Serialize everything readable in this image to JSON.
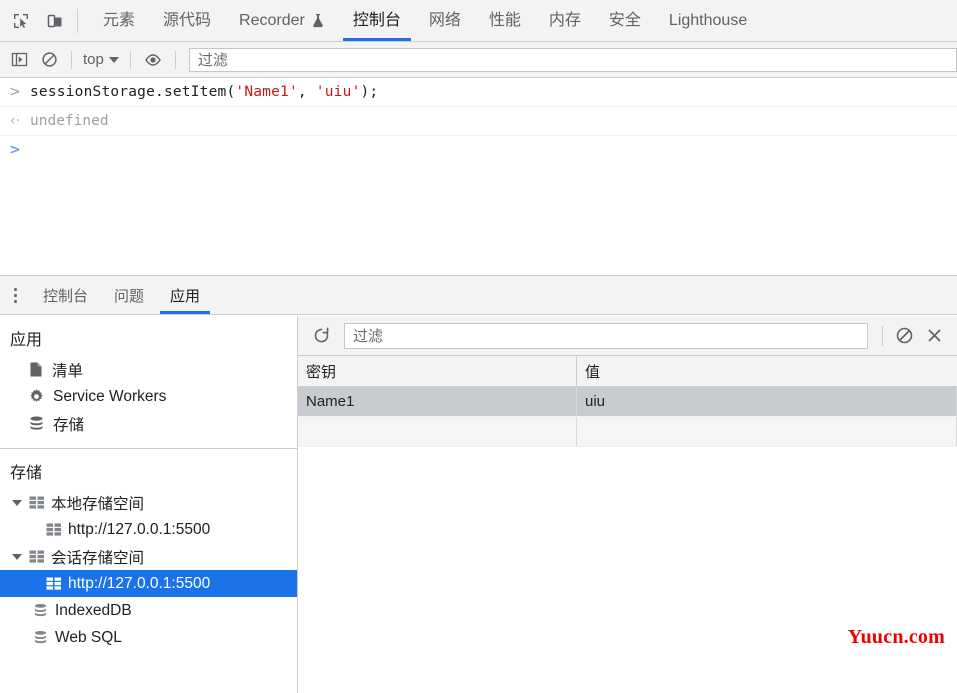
{
  "main_tabbar": {
    "inspect_icon": "inspect-cursor-icon",
    "device_icon": "device-toolbar-icon",
    "tabs": [
      {
        "label": "元素",
        "name": "tab-elements",
        "active": false
      },
      {
        "label": "源代码",
        "name": "tab-sources",
        "active": false
      },
      {
        "label": "Recorder",
        "name": "tab-recorder",
        "active": false,
        "icon": "experiment-flask-icon"
      },
      {
        "label": "控制台",
        "name": "tab-console",
        "active": true
      },
      {
        "label": "网络",
        "name": "tab-network",
        "active": false
      },
      {
        "label": "性能",
        "name": "tab-performance",
        "active": false
      },
      {
        "label": "内存",
        "name": "tab-memory",
        "active": false
      },
      {
        "label": "安全",
        "name": "tab-security",
        "active": false
      },
      {
        "label": "Lighthouse",
        "name": "tab-lighthouse",
        "active": false
      }
    ]
  },
  "console_toolbar": {
    "sidebar_toggle_icon": "console-sidebar-icon",
    "clear_icon": "clear-console-icon",
    "context": "top",
    "eye_icon": "live-expression-eye-icon",
    "filter_placeholder": "过滤"
  },
  "console": {
    "entries": [
      {
        "gutter": ">",
        "type": "input",
        "parts": [
          {
            "text": "sessionStorage.setItem(",
            "kind": "code"
          },
          {
            "text": "'Name1'",
            "kind": "string"
          },
          {
            "text": ", ",
            "kind": "code"
          },
          {
            "text": "'uiu'",
            "kind": "string"
          },
          {
            "text": ");",
            "kind": "code"
          }
        ]
      },
      {
        "gutter": "‹·",
        "type": "output",
        "text": "undefined"
      }
    ],
    "prompt_gutter": ">"
  },
  "drawer": {
    "kebab_icon": "more-options-icon",
    "tabs": [
      {
        "label": "控制台",
        "name": "drawer-tab-console",
        "active": false
      },
      {
        "label": "问题",
        "name": "drawer-tab-issues",
        "active": false
      },
      {
        "label": "应用",
        "name": "drawer-tab-application",
        "active": true
      }
    ]
  },
  "sidebar": {
    "application": {
      "title": "应用",
      "items": [
        {
          "label": "清单",
          "icon": "manifest-document-icon",
          "name": "sidebar-item-manifest"
        },
        {
          "label": "Service Workers",
          "icon": "gear-icon",
          "name": "sidebar-item-service-workers"
        },
        {
          "label": "存储",
          "icon": "database-icon",
          "name": "sidebar-item-storage"
        }
      ]
    },
    "storage": {
      "title": "存储",
      "tree": [
        {
          "label": "本地存储空间",
          "icon": "table-grid-icon",
          "expanded": true,
          "depth": 1,
          "selected": false,
          "name": "tree-local-storage"
        },
        {
          "label": "http://127.0.0.1:5500",
          "icon": "table-grid-icon",
          "depth": 2,
          "selected": false,
          "name": "tree-local-storage-origin"
        },
        {
          "label": "会话存储空间",
          "icon": "table-grid-icon",
          "expanded": true,
          "depth": 1,
          "selected": false,
          "name": "tree-session-storage"
        },
        {
          "label": "http://127.0.0.1:5500",
          "icon": "table-grid-icon",
          "depth": 2,
          "selected": true,
          "name": "tree-session-storage-origin"
        },
        {
          "label": "IndexedDB",
          "icon": "database-icon",
          "depth": 1.5,
          "selected": false,
          "name": "tree-indexeddb"
        },
        {
          "label": "Web SQL",
          "icon": "database-icon",
          "depth": 1.5,
          "selected": false,
          "name": "tree-web-sql"
        }
      ]
    }
  },
  "storage_panel": {
    "refresh_icon": "refresh-icon",
    "clear_icon": "clear-all-icon",
    "delete_icon": "delete-selected-icon",
    "filter_placeholder": "过滤",
    "columns": [
      {
        "label": "密钥",
        "name": "column-header-key"
      },
      {
        "label": "值",
        "name": "column-header-value"
      }
    ],
    "rows": [
      {
        "key": "Name1",
        "value": "uiu",
        "selected": true
      }
    ],
    "empty_rows": 1
  },
  "watermark": {
    "text": "Yuucn.com"
  },
  "colors": {
    "accent": "#1a73e8",
    "toolbar_bg": "#f3f3f3",
    "border": "#cdcdcd",
    "selected_row": "#c8ccd0",
    "string_literal": "#c41a16",
    "watermark": "#ee0000"
  }
}
